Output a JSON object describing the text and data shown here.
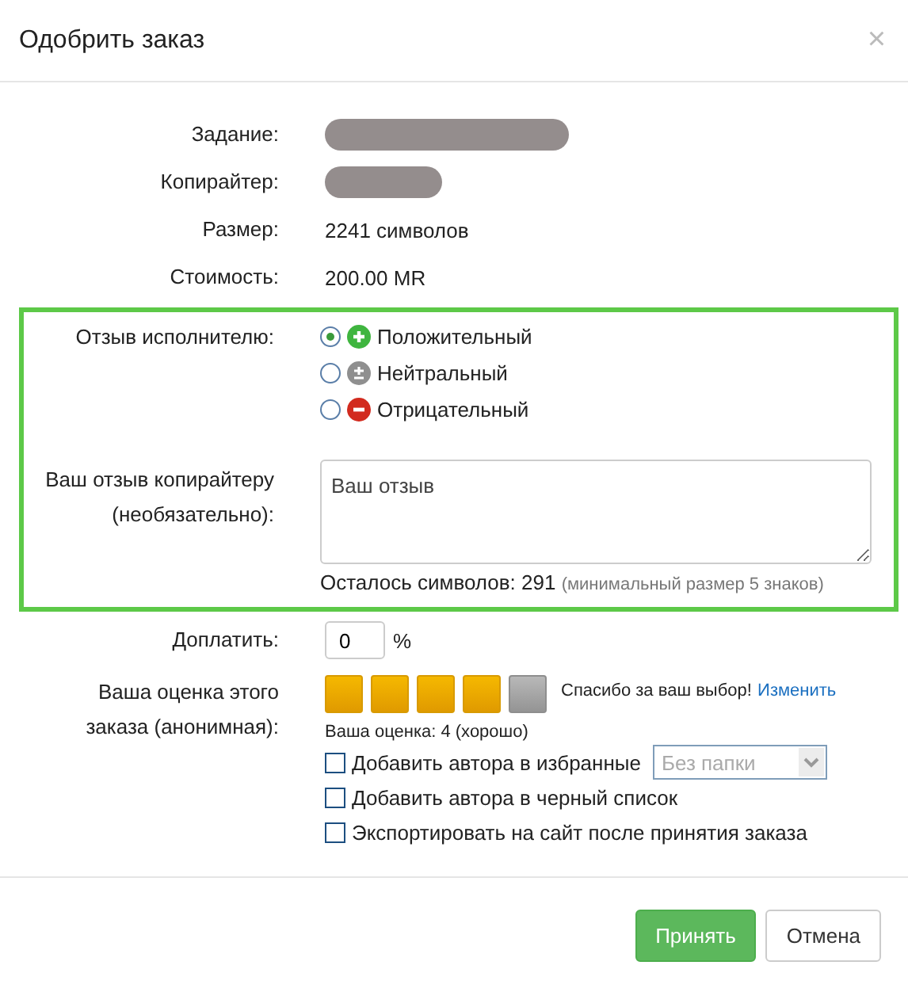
{
  "dialog": {
    "title": "Одобрить заказ",
    "close": "×"
  },
  "info_rows": [
    {
      "label": "Задание:",
      "kind": "redacted"
    },
    {
      "label": "Копирайтер:",
      "kind": "redacted"
    },
    {
      "label": "Размер:",
      "kind": "text",
      "value": "2241 символов"
    },
    {
      "label": "Стоимость:",
      "kind": "text",
      "value": "200.00 MR"
    }
  ],
  "feedback": {
    "label": "Отзыв исполнителю:",
    "options": [
      {
        "label": "Положительный",
        "kind": "positive",
        "selected": true
      },
      {
        "label": "Нейтральный",
        "kind": "neutral",
        "selected": false
      },
      {
        "label": "Отрицательный",
        "kind": "negative",
        "selected": false
      }
    ],
    "comment_label_1": "Ваш отзыв копирайтеру",
    "comment_label_2": "(необязательно):",
    "comment_placeholder": "Ваш отзыв",
    "remaining": "Осталось символов: 291",
    "remaining_note": "(минимальный размер 5 знаков)"
  },
  "extra_pay": {
    "label": "Доплатить:",
    "value": "0",
    "unit": "%"
  },
  "rating": {
    "label_1": "Ваша оценка этого",
    "label_2": "заказа (анонимная):",
    "stars": 4,
    "thanks": "Спасибо за ваш выбор!",
    "change": "Изменить",
    "summary": "Ваша оценка: 4 (хорошо)"
  },
  "options": [
    {
      "label": "Добавить автора в избранные",
      "checked": false,
      "select": "Без папки"
    },
    {
      "label": "Добавить автора в черный список",
      "checked": false
    },
    {
      "label": "Экспортировать на сайт после принятия заказа",
      "checked": false
    }
  ],
  "buttons": [
    {
      "label": "Принять",
      "kind": "primary"
    },
    {
      "label": "Отмена",
      "kind": "default"
    }
  ]
}
